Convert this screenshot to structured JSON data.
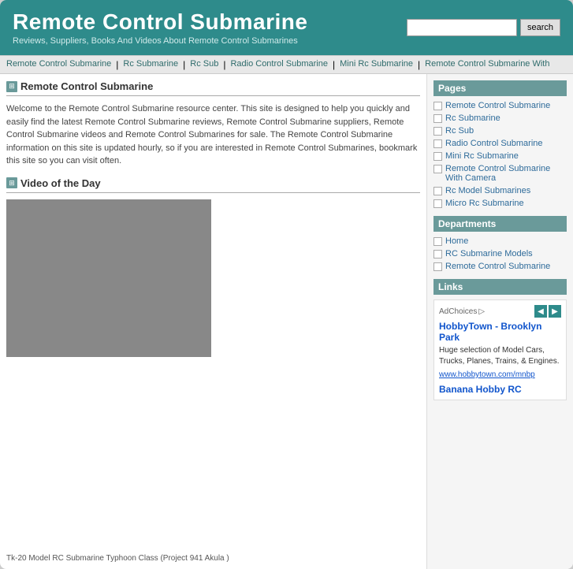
{
  "header": {
    "title": "Remote Control Submarine",
    "subtitle": "Reviews, Suppliers, Books And Videos About Remote Control Submarines",
    "search_placeholder": "",
    "search_button": "search"
  },
  "navbar": {
    "links": [
      "Remote Control Submarine",
      "Rc Submarine",
      "Rc Sub",
      "Radio Control Submarine",
      "Mini Rc Submarine",
      "Remote Control Submarine With"
    ]
  },
  "main_section": {
    "title": "Remote Control Submarine",
    "intro": "Welcome to the Remote Control Submarine resource center. This site is designed to help you quickly and easily find the latest Remote Control Submarine reviews, Remote Control Submarine suppliers, Remote Control Submarine videos and Remote Control Submarines for sale.\nThe Remote Control Submarine information on this site is updated hourly, so if you are interested in Remote Control Submarines, bookmark this site so you can visit often."
  },
  "video_section": {
    "title": "Video of the Day",
    "caption": "Tk-20 Model RC Submarine Typhoon Class (Project 941 Akula )"
  },
  "sidebar": {
    "pages_title": "Pages",
    "pages_links": [
      "Remote Control Submarine",
      "Rc Submarine",
      "Rc Sub",
      "Radio Control Submarine",
      "Mini Rc Submarine",
      "Remote Control Submarine With Camera",
      "Rc Model Submarines",
      "Micro Rc Submarine"
    ],
    "departments_title": "Departments",
    "departments_links": [
      "Home",
      "RC Submarine Models",
      "Remote Control Submarine"
    ],
    "links_title": "Links",
    "ad_choices": "AdChoices",
    "ad1_title": "HobbyTown - Brooklyn Park",
    "ad1_desc": "Huge selection of Model Cars, Trucks, Planes, Trains, & Engines.",
    "ad1_url": "www.hobbytown.com/mnbp",
    "ad2_title": "Banana Hobby RC"
  }
}
